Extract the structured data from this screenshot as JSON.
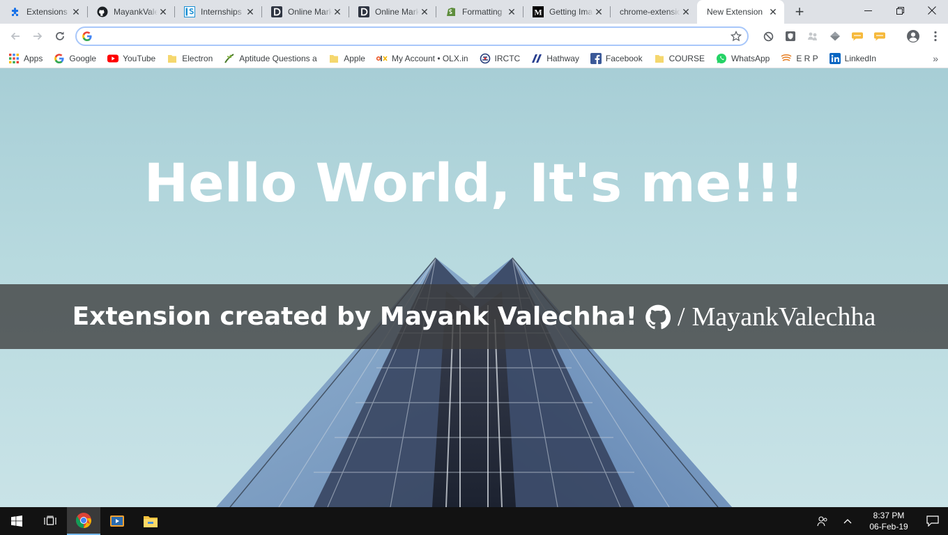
{
  "tabs": [
    {
      "title": "Extensions",
      "icon": "puzzle-icon",
      "active": false
    },
    {
      "title": "MayankValechha",
      "icon": "github-icon",
      "active": false
    },
    {
      "title": "Internships",
      "icon": "internshala-icon",
      "active": false
    },
    {
      "title": "Online Marketing",
      "icon": "d-logo-icon",
      "active": false
    },
    {
      "title": "Online Marketing",
      "icon": "d-logo-icon",
      "active": false
    },
    {
      "title": "Formatting",
      "icon": "shopify-icon",
      "active": false
    },
    {
      "title": "Getting Images",
      "icon": "medium-icon",
      "active": false
    },
    {
      "title": "chrome-extension",
      "icon": "",
      "active": false
    },
    {
      "title": "New Extension",
      "icon": "",
      "active": true
    }
  ],
  "omnibox": {
    "value": "",
    "placeholder": ""
  },
  "bookmarks": [
    {
      "label": "Apps",
      "icon": "apps-grid-icon"
    },
    {
      "label": "Google",
      "icon": "google-icon"
    },
    {
      "label": "YouTube",
      "icon": "youtube-icon"
    },
    {
      "label": "Electron",
      "icon": "folder-icon"
    },
    {
      "label": "Aptitude Questions a",
      "icon": "aptitude-icon"
    },
    {
      "label": "Apple",
      "icon": "folder-icon"
    },
    {
      "label": "My Account • OLX.in",
      "icon": "olx-icon"
    },
    {
      "label": "IRCTC",
      "icon": "irctc-icon"
    },
    {
      "label": "Hathway",
      "icon": "hathway-icon"
    },
    {
      "label": "Facebook",
      "icon": "facebook-icon"
    },
    {
      "label": "COURSE",
      "icon": "folder-icon"
    },
    {
      "label": "WhatsApp",
      "icon": "whatsapp-icon"
    },
    {
      "label": "E R P",
      "icon": "erp-icon"
    },
    {
      "label": "LinkedIn",
      "icon": "linkedin-icon"
    }
  ],
  "page": {
    "heading": "Hello World, It's me!!!",
    "credit": "Extension created by Mayank Valechha!",
    "separator": "/",
    "github_handle": "MayankValechha"
  },
  "taskbar": {
    "time": "8:37 PM",
    "date": "06-Feb-19"
  },
  "colors": {
    "tabstrip": "#dee1e6",
    "banner": "#3c3c3c",
    "sky_top": "#a7ced6",
    "sky_bottom": "#c9e3e7",
    "taskbar": "#121212"
  }
}
